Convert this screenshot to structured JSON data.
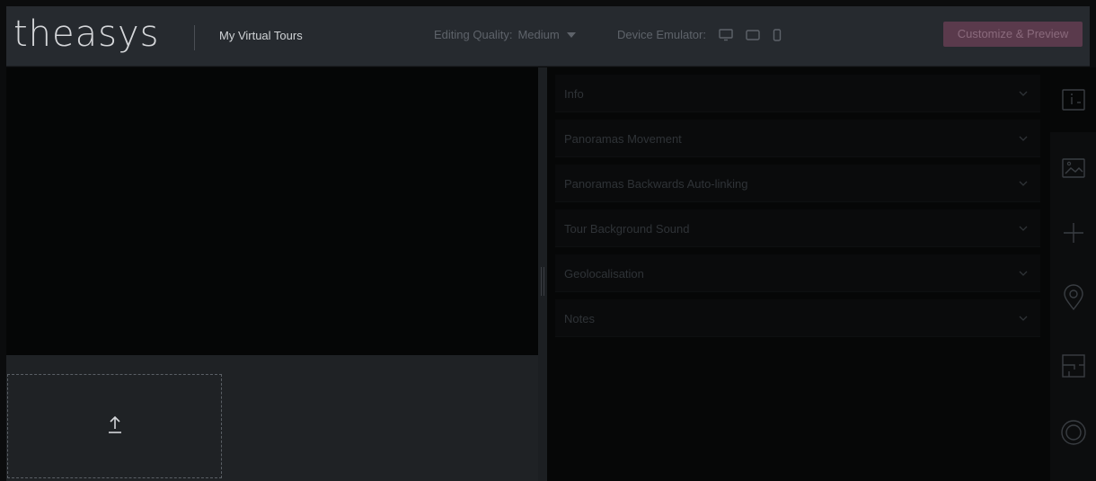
{
  "topbar": {
    "logo": "theasys",
    "my_tours": "My Virtual Tours",
    "quality_label": "Editing Quality:",
    "quality_value": "Medium",
    "device_label": "Device Emulator:",
    "cta": "Customize & Preview"
  },
  "panel": {
    "sections": [
      "Info",
      "Panoramas Movement",
      "Panoramas Backwards Auto-linking",
      "Tour Background Sound",
      "Geolocalisation",
      "Notes"
    ]
  },
  "upload": {
    "icon": "upload-arrow-icon"
  },
  "rail": {
    "icons": [
      "info-icon",
      "image-icon",
      "plus-icon",
      "location-pin-icon",
      "floorplan-icon",
      "circle-target-icon"
    ]
  },
  "colors": {
    "accent": "#5a3a4c",
    "topbar": "#262a2f",
    "background": "#0b0c0d"
  }
}
